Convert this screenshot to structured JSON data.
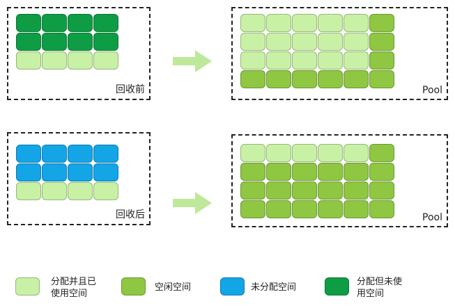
{
  "colors": {
    "allocated_used": "#c9f1a6",
    "free": "#8fc743",
    "unallocated": "#13a5e6",
    "allocated_unused": "#0e9d45",
    "border": "#222222",
    "arrow": "#bfe99a"
  },
  "panels": {
    "before": {
      "label": "回收前",
      "rows": [
        [
          "allocated_unused",
          "allocated_unused",
          "allocated_unused",
          "allocated_unused"
        ],
        [
          "allocated_unused",
          "allocated_unused",
          "allocated_unused",
          "allocated_unused"
        ],
        [
          "allocated_used",
          "allocated_used",
          "allocated_used",
          "allocated_used"
        ]
      ]
    },
    "pool_top": {
      "label": "Pool",
      "rows": [
        [
          "allocated_used",
          "allocated_used",
          "allocated_used",
          "allocated_used",
          "allocated_used",
          "free"
        ],
        [
          "allocated_used",
          "allocated_used",
          "allocated_used",
          "allocated_used",
          "allocated_used",
          "free"
        ],
        [
          "allocated_used",
          "allocated_used",
          "allocated_used",
          "allocated_used",
          "allocated_used",
          "free"
        ],
        [
          "free",
          "free",
          "free",
          "free",
          "free",
          "free"
        ]
      ]
    },
    "after": {
      "label": "回收后",
      "rows": [
        [
          "unallocated",
          "unallocated",
          "unallocated",
          "unallocated"
        ],
        [
          "unallocated",
          "unallocated",
          "unallocated",
          "unallocated"
        ],
        [
          "allocated_used",
          "allocated_used",
          "allocated_used",
          "allocated_used"
        ]
      ]
    },
    "pool_bottom": {
      "label": "Pool",
      "rows": [
        [
          "allocated_used",
          "allocated_used",
          "allocated_used",
          "allocated_used",
          "allocated_used",
          "free"
        ],
        [
          "free",
          "free",
          "free",
          "free",
          "free",
          "free"
        ],
        [
          "free",
          "free",
          "free",
          "free",
          "free",
          "free"
        ],
        [
          "free",
          "free",
          "free",
          "free",
          "free",
          "free"
        ]
      ]
    }
  },
  "legend": {
    "allocated_used": {
      "line1": "分配并且已",
      "line2": "使用空间"
    },
    "free": {
      "line1": "空闲空间",
      "line2": ""
    },
    "unallocated": {
      "line1": "未分配空间",
      "line2": ""
    },
    "allocated_unused": {
      "line1": "分配但未使",
      "line2": "用空间"
    }
  }
}
